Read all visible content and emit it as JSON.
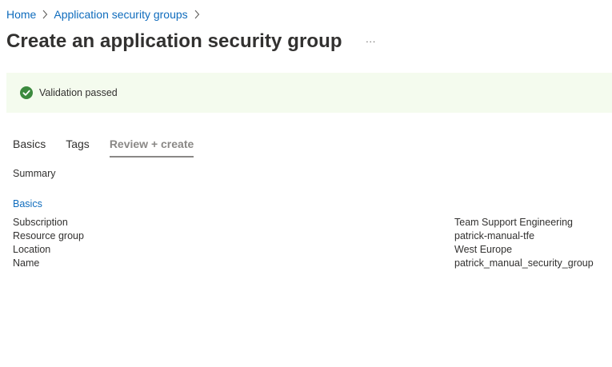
{
  "breadcrumb": {
    "home": "Home",
    "parent": "Application security groups"
  },
  "page": {
    "title": "Create an application security group",
    "more": "..."
  },
  "banner": {
    "status": "success",
    "text": "Validation passed",
    "color": "#3b8a3e",
    "background": "#f4fbee"
  },
  "tabs": [
    {
      "label": "Basics",
      "active": false
    },
    {
      "label": "Tags",
      "active": false
    },
    {
      "label": "Review + create",
      "active": true
    }
  ],
  "summary": {
    "label": "Summary",
    "section_title": "Basics",
    "rows": [
      {
        "key": "Subscription",
        "value": "Team Support Engineering"
      },
      {
        "key": "Resource group",
        "value": "patrick-manual-tfe"
      },
      {
        "key": "Location",
        "value": "West Europe"
      },
      {
        "key": "Name",
        "value": "patrick_manual_security_group"
      }
    ]
  },
  "icons": {
    "breadcrumb_separator": "chevron-right-icon",
    "banner": "checkmark-circle-icon",
    "more": "more-horizontal-icon"
  },
  "colors": {
    "link": "#0f6cbd",
    "text": "#323130",
    "active_tab": "#8a8886"
  }
}
